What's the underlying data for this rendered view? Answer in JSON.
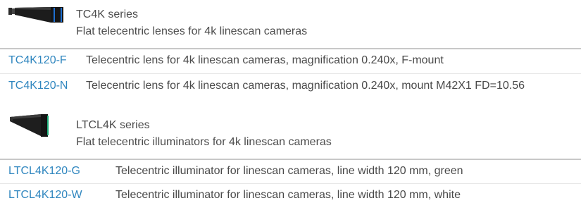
{
  "sections": [
    {
      "image_icon": "telecentric-lens-image",
      "title": "TC4K series",
      "subtitle": "Flat telecentric lenses for 4k linescan cameras",
      "rows": [
        {
          "code": "TC4K120-F",
          "description": "Telecentric lens for 4k linescan cameras, magnification 0.240x, F-mount"
        },
        {
          "code": "TC4K120-N",
          "description": "Telecentric lens for 4k linescan cameras, magnification 0.240x, mount M42X1 FD=10.56"
        }
      ]
    },
    {
      "image_icon": "telecentric-illuminator-image",
      "title": "LTCL4K series",
      "subtitle": "Flat telecentric illuminators for 4k linescan cameras",
      "rows": [
        {
          "code": "LTCL4K120-G",
          "description": "Telecentric illuminator for linescan cameras, line width 120 mm, green"
        },
        {
          "code": "LTCL4K120-W",
          "description": "Telecentric illuminator for linescan cameras, line width 120 mm, white"
        }
      ]
    }
  ],
  "colors": {
    "link": "#2f86bf",
    "text": "#4a4a4a",
    "accent_blue": "#1e6fd0",
    "accent_green": "#1fae7a"
  }
}
